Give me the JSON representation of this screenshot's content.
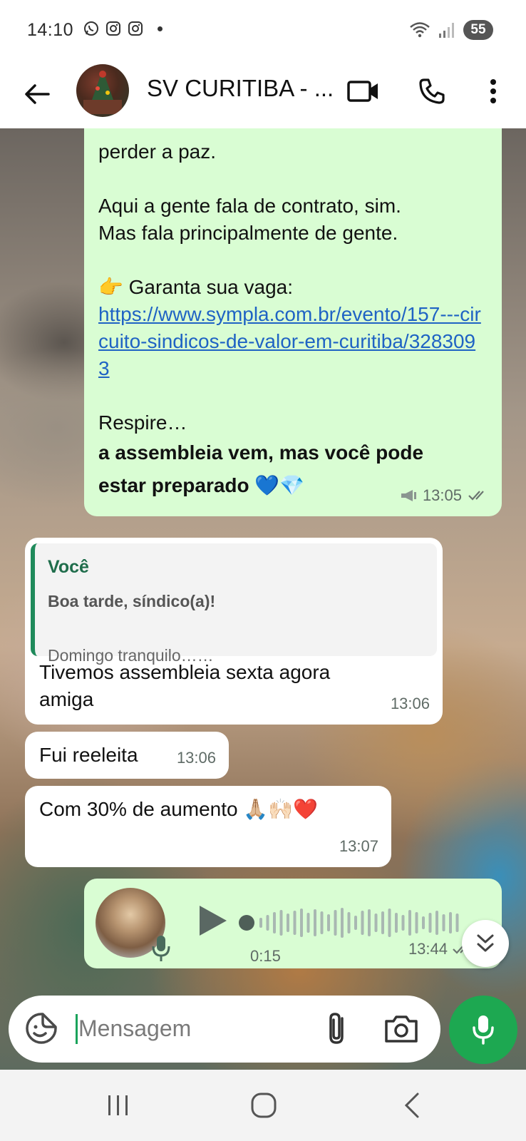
{
  "status_bar": {
    "time": "14:10",
    "battery": "55",
    "icons": [
      "whatsapp-icon",
      "instagram-icon",
      "instagram-icon",
      "dot-icon",
      "wifi-icon",
      "signal-icon"
    ]
  },
  "header": {
    "title": "SV CURITIBA - ...",
    "icons": [
      "back-arrow-icon",
      "video-call-icon",
      "phone-icon",
      "more-vert-icon"
    ]
  },
  "messages": {
    "big": {
      "line1": "perder a paz.",
      "line2": "Aqui a gente fala de contrato, sim.",
      "line3": "Mas fala principalmente de gente.",
      "line4": "👉 Garanta sua vaga:",
      "link": "https://www.sympla.com.br/evento/157---circuito-sindicos-de-valor-em-curitiba/3283093",
      "line5": "Respire…",
      "bold1": "a assembleia vem, mas você pode",
      "bold2": "estar preparado 💙💎",
      "time": "13:05"
    },
    "reply": {
      "quote_author": "Você",
      "quote_line1": "Boa tarde, síndico(a)!",
      "quote_line2": "Domingo tranquilo……",
      "text": "Tivemos assembleia sexta agora amiga",
      "time": "13:06"
    },
    "fui": {
      "text": "Fui reeleita",
      "time": "13:06"
    },
    "com": {
      "text": "Com 30% de aumento 🙏🏼🙌🏻❤️",
      "time": "13:07"
    },
    "audio": {
      "duration": "0:15",
      "time": "13:44"
    }
  },
  "input": {
    "placeholder": "Mensagem"
  },
  "colors": {
    "outgoing": "#d9fdd3",
    "incoming": "#ffffff",
    "accent": "#1da851",
    "link": "#1f63c4"
  }
}
